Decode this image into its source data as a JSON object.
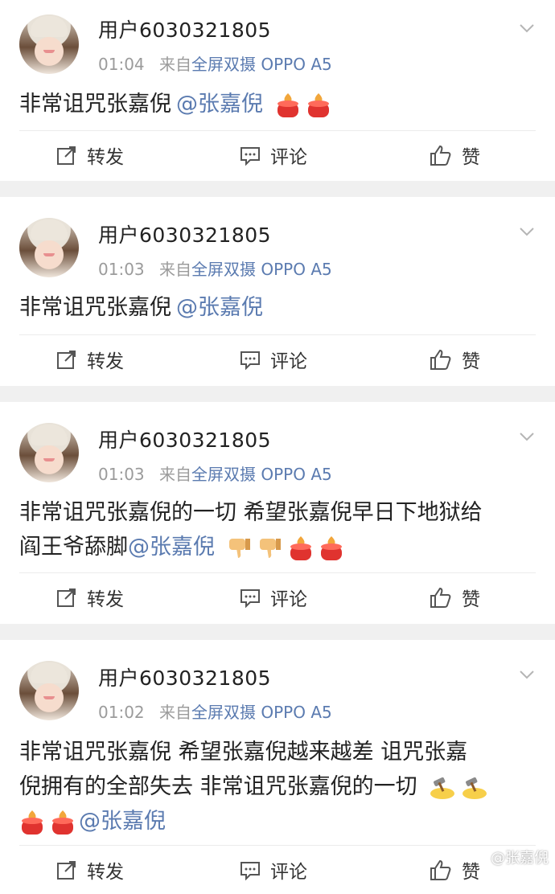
{
  "posts": [
    {
      "username": "用户6030321805",
      "time": "01:04",
      "source_prefix": "来自",
      "source": "全屏双摄 OPPO A5",
      "text": "非常诅咒张嘉倪",
      "mention": "@张嘉倪",
      "emojis": [
        "candle-icon",
        "candle-icon"
      ]
    },
    {
      "username": "用户6030321805",
      "time": "01:03",
      "source_prefix": "来自",
      "source": "全屏双摄 OPPO A5",
      "text": "非常诅咒张嘉倪",
      "mention": "@张嘉倪",
      "emojis": []
    },
    {
      "username": "用户6030321805",
      "time": "01:03",
      "source_prefix": "来自",
      "source": "全屏双摄 OPPO A5",
      "text_line1": "非常诅咒张嘉倪的一切 希望张嘉倪早日下地狱给",
      "text_line2": "阎王爷舔脚",
      "mention": "@张嘉倪",
      "emojis": [
        "thumbs-down-icon",
        "thumbs-down-icon",
        "candle-icon",
        "candle-icon"
      ]
    },
    {
      "username": "用户6030321805",
      "time": "01:02",
      "source_prefix": "来自",
      "source": "全屏双摄 OPPO A5",
      "text_line1": "非常诅咒张嘉倪 希望张嘉倪越来越差 诅咒张嘉",
      "text_line2": "倪拥有的全部失去 非常诅咒张嘉倪的一切",
      "mention": "@张嘉倪",
      "emojis": [
        "hammer-icon",
        "hammer-icon",
        "candle-icon",
        "candle-icon"
      ]
    }
  ],
  "actions": {
    "repost": "转发",
    "comment": "评论",
    "like": "赞"
  },
  "watermark": "@张嘉倪",
  "colors": {
    "link": "#5b7bb0",
    "meta": "#9b9b9b",
    "separator": "#f0f0f0"
  }
}
